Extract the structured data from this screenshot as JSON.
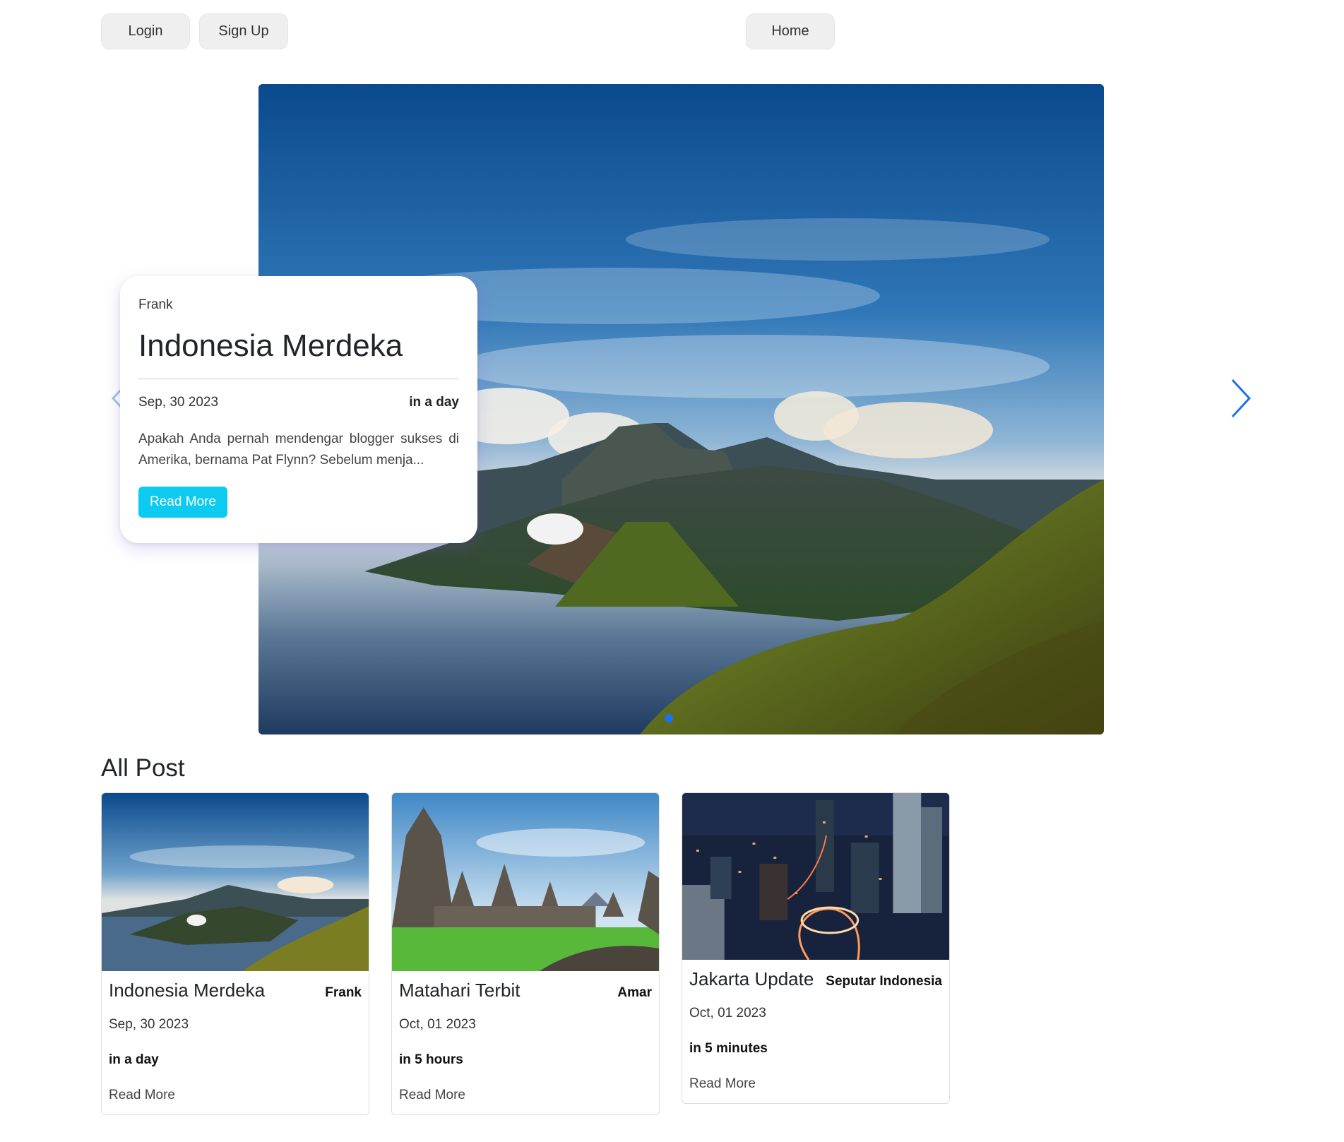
{
  "nav": {
    "login_label": "Login",
    "signup_label": "Sign Up",
    "home_label": "Home"
  },
  "hero": {
    "author": "Frank",
    "title": "Indonesia Merdeka",
    "date": "Sep, 30 2023",
    "relative_time": "in a day",
    "excerpt": "Apakah Anda pernah mendengar blogger sukses di Amerika, bernama Pat Flynn? Sebelum menja...",
    "read_more_label": "Read More",
    "prev_icon": "chevron-left-icon",
    "next_icon": "chevron-right-icon",
    "accent_color": "#0dcaf0"
  },
  "posts_section": {
    "title": "All Post",
    "posts": [
      {
        "title": "Indonesia Merdeka",
        "author": "Frank",
        "date": "Sep, 30 2023",
        "relative_time": "in a day",
        "link_label": "Read More",
        "image": "mountain-landscape"
      },
      {
        "title": "Matahari Terbit",
        "author": "Amar",
        "date": "Oct, 01 2023",
        "relative_time": "in 5 hours",
        "link_label": "Read More",
        "image": "temple-landscape"
      },
      {
        "title": "Jakarta Update",
        "author": "Seputar Indonesia",
        "date": "Oct, 01 2023",
        "relative_time": "in 5 minutes",
        "link_label": "Read More",
        "image": "city-night"
      }
    ]
  }
}
